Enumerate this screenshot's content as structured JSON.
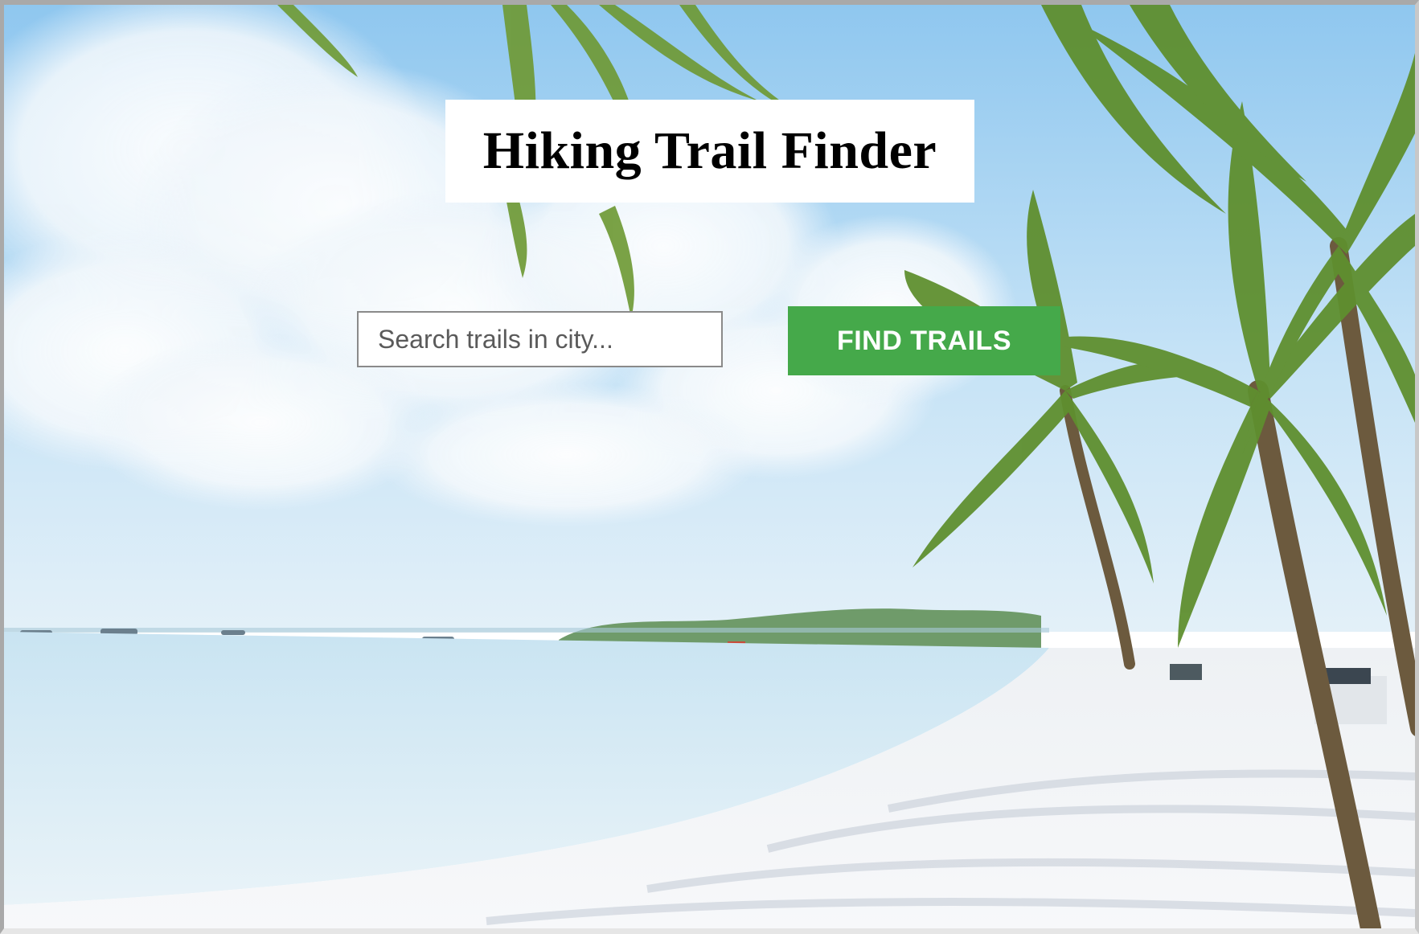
{
  "page": {
    "title": "Hiking Trail Finder"
  },
  "search": {
    "placeholder": "Search trails in city...",
    "value": ""
  },
  "actions": {
    "find_label": "FIND TRAILS"
  },
  "colors": {
    "button": "#45a94a",
    "sky": "#9ecff1",
    "sea": "#cfe7f3",
    "sand": "#f4f5f7",
    "palm": "#5f8f2f"
  }
}
